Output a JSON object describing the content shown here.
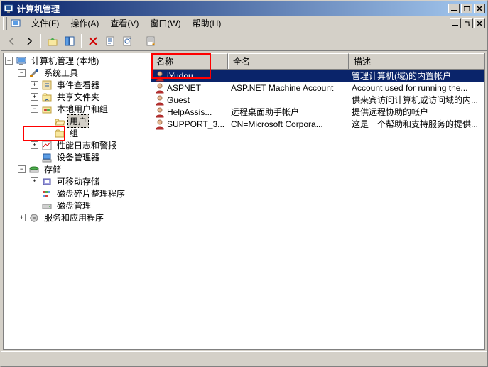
{
  "window": {
    "title": "计算机管理"
  },
  "menu": {
    "file": "文件(F)",
    "action": "操作(A)",
    "view": "查看(V)",
    "window": "窗口(W)",
    "help": "帮助(H)"
  },
  "tree": {
    "root": "计算机管理 (本地)",
    "system_tools": "系统工具",
    "event_viewer": "事件查看器",
    "shared_folders": "共享文件夹",
    "local_users_groups": "本地用户和组",
    "users": "用户",
    "groups": "组",
    "perf_logs": "性能日志和警报",
    "device_mgr": "设备管理器",
    "storage": "存储",
    "removable": "可移动存储",
    "defrag": "磁盘碎片整理程序",
    "disk_mgmt": "磁盘管理",
    "services_apps": "服务和应用程序"
  },
  "list": {
    "headers": {
      "name": "名称",
      "fullname": "全名",
      "desc": "描述"
    },
    "rows": [
      {
        "name": "iYudou",
        "fullname": "",
        "desc": "管理计算机(域)的内置帐户"
      },
      {
        "name": "ASPNET",
        "fullname": "ASP.NET Machine Account",
        "desc": "Account used for running the..."
      },
      {
        "name": "Guest",
        "fullname": "",
        "desc": "供来宾访问计算机或访问域的内..."
      },
      {
        "name": "HelpAssis...",
        "fullname": "远程桌面助手帐户",
        "desc": "提供远程协助的帐户"
      },
      {
        "name": "SUPPORT_3...",
        "fullname": "CN=Microsoft Corpora...",
        "desc": "这是一个帮助和支持服务的提供..."
      }
    ]
  }
}
